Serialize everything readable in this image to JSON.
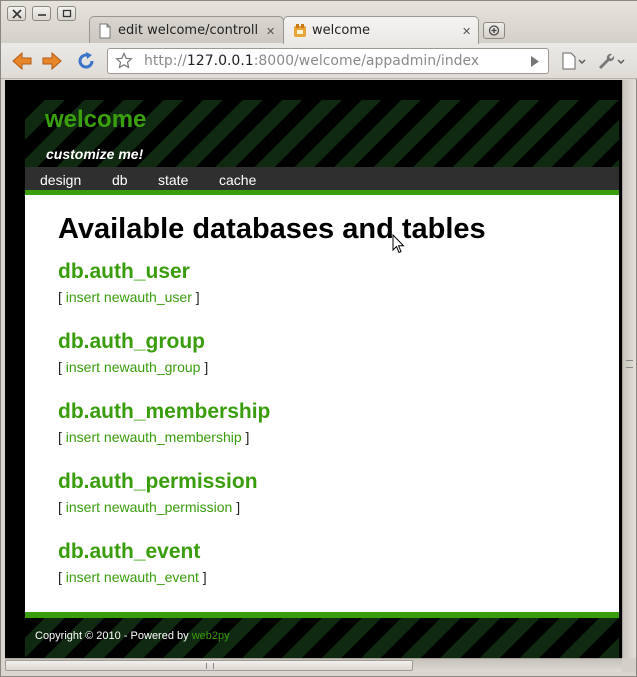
{
  "browser": {
    "tabs": [
      {
        "title": "edit welcome/controll...",
        "active": false
      },
      {
        "title": "welcome",
        "active": true
      }
    ],
    "url": {
      "scheme": "http://",
      "host": "127.0.0.1",
      "rest": ":8000/welcome/appadmin/index"
    }
  },
  "site": {
    "title": "welcome",
    "subtitle": "customize me!",
    "menu": [
      "design",
      "db",
      "state",
      "cache"
    ]
  },
  "main": {
    "heading": "Available databases and tables",
    "databases": [
      {
        "name": "db.auth_user",
        "link": "insert newauth_user"
      },
      {
        "name": "db.auth_group",
        "link": "insert newauth_group"
      },
      {
        "name": "db.auth_membership",
        "link": "insert newauth_membership"
      },
      {
        "name": "db.auth_permission",
        "link": "insert newauth_permission"
      },
      {
        "name": "db.auth_event",
        "link": "insert newauth_event"
      }
    ],
    "bracket_open": "[",
    "bracket_close": "]"
  },
  "footer": {
    "text": "Copyright © 2010 - Powered by",
    "link": "web2py"
  },
  "colors": {
    "accent_green": "#3a9d0d",
    "menubar": "#2f2f2f"
  }
}
